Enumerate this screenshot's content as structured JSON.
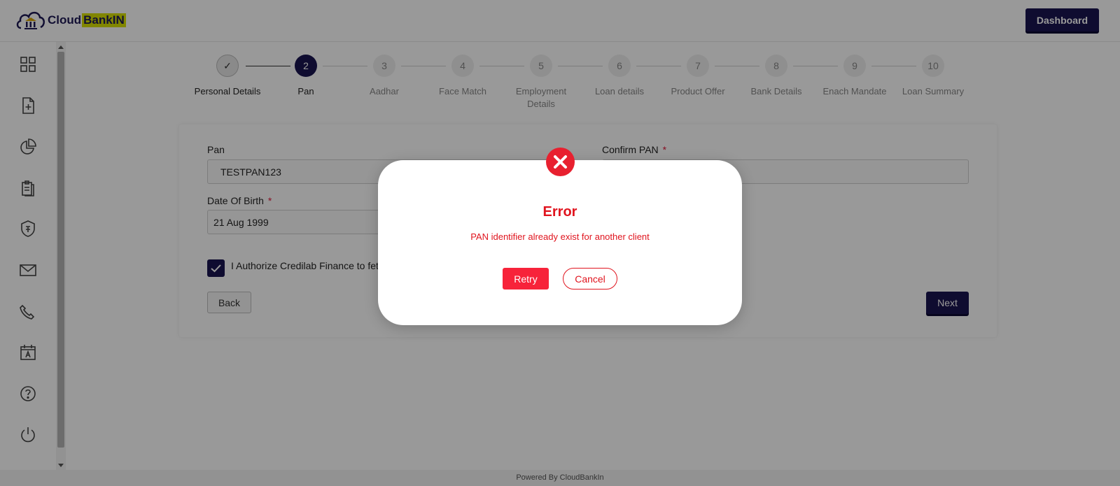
{
  "header": {
    "logo_text_main": "Cloud",
    "logo_text_accent": "BankIN",
    "dashboard_label": "Dashboard"
  },
  "sidebar": {
    "items": [
      {
        "icon": "grid-icon"
      },
      {
        "icon": "file-plus-icon"
      },
      {
        "icon": "pie-chart-icon"
      },
      {
        "icon": "clipboard-icon"
      },
      {
        "icon": "shield-icon"
      },
      {
        "icon": "mail-icon"
      },
      {
        "icon": "phone-icon"
      },
      {
        "icon": "calendar-icon"
      },
      {
        "icon": "help-icon"
      },
      {
        "icon": "power-icon"
      }
    ]
  },
  "stepper": {
    "steps": [
      {
        "number": "✓",
        "label": "Personal Details",
        "state": "done"
      },
      {
        "number": "2",
        "label": "Pan",
        "state": "active"
      },
      {
        "number": "3",
        "label": "Aadhar",
        "state": "pending"
      },
      {
        "number": "4",
        "label": "Face Match",
        "state": "pending"
      },
      {
        "number": "5",
        "label": "Employment Details",
        "state": "pending"
      },
      {
        "number": "6",
        "label": "Loan details",
        "state": "pending"
      },
      {
        "number": "7",
        "label": "Product Offer",
        "state": "pending"
      },
      {
        "number": "8",
        "label": "Bank Details",
        "state": "pending"
      },
      {
        "number": "9",
        "label": "Enach Mandate",
        "state": "pending"
      },
      {
        "number": "10",
        "label": "Loan Summary",
        "state": "pending"
      }
    ]
  },
  "form": {
    "pan_label": "Pan",
    "pan_value": "TESTPAN123",
    "confirm_pan_label": "Confirm PAN",
    "confirm_pan_value": "",
    "required_mark": "*",
    "dob_label": "Date Of Birth",
    "dob_value": "21 Aug 1999",
    "authorize_text": "I Authorize Credilab Finance to fet",
    "authorize_checked": true,
    "back_label": "Back",
    "next_label": "Next"
  },
  "footer": {
    "text": "Powered By CloudBankIn"
  },
  "modal": {
    "title": "Error",
    "message": "PAN identifier already exist for another client",
    "retry_label": "Retry",
    "cancel_label": "Cancel"
  },
  "colors": {
    "primary": "#1a1450",
    "error": "#e0141e",
    "accent": "#d7e000"
  }
}
